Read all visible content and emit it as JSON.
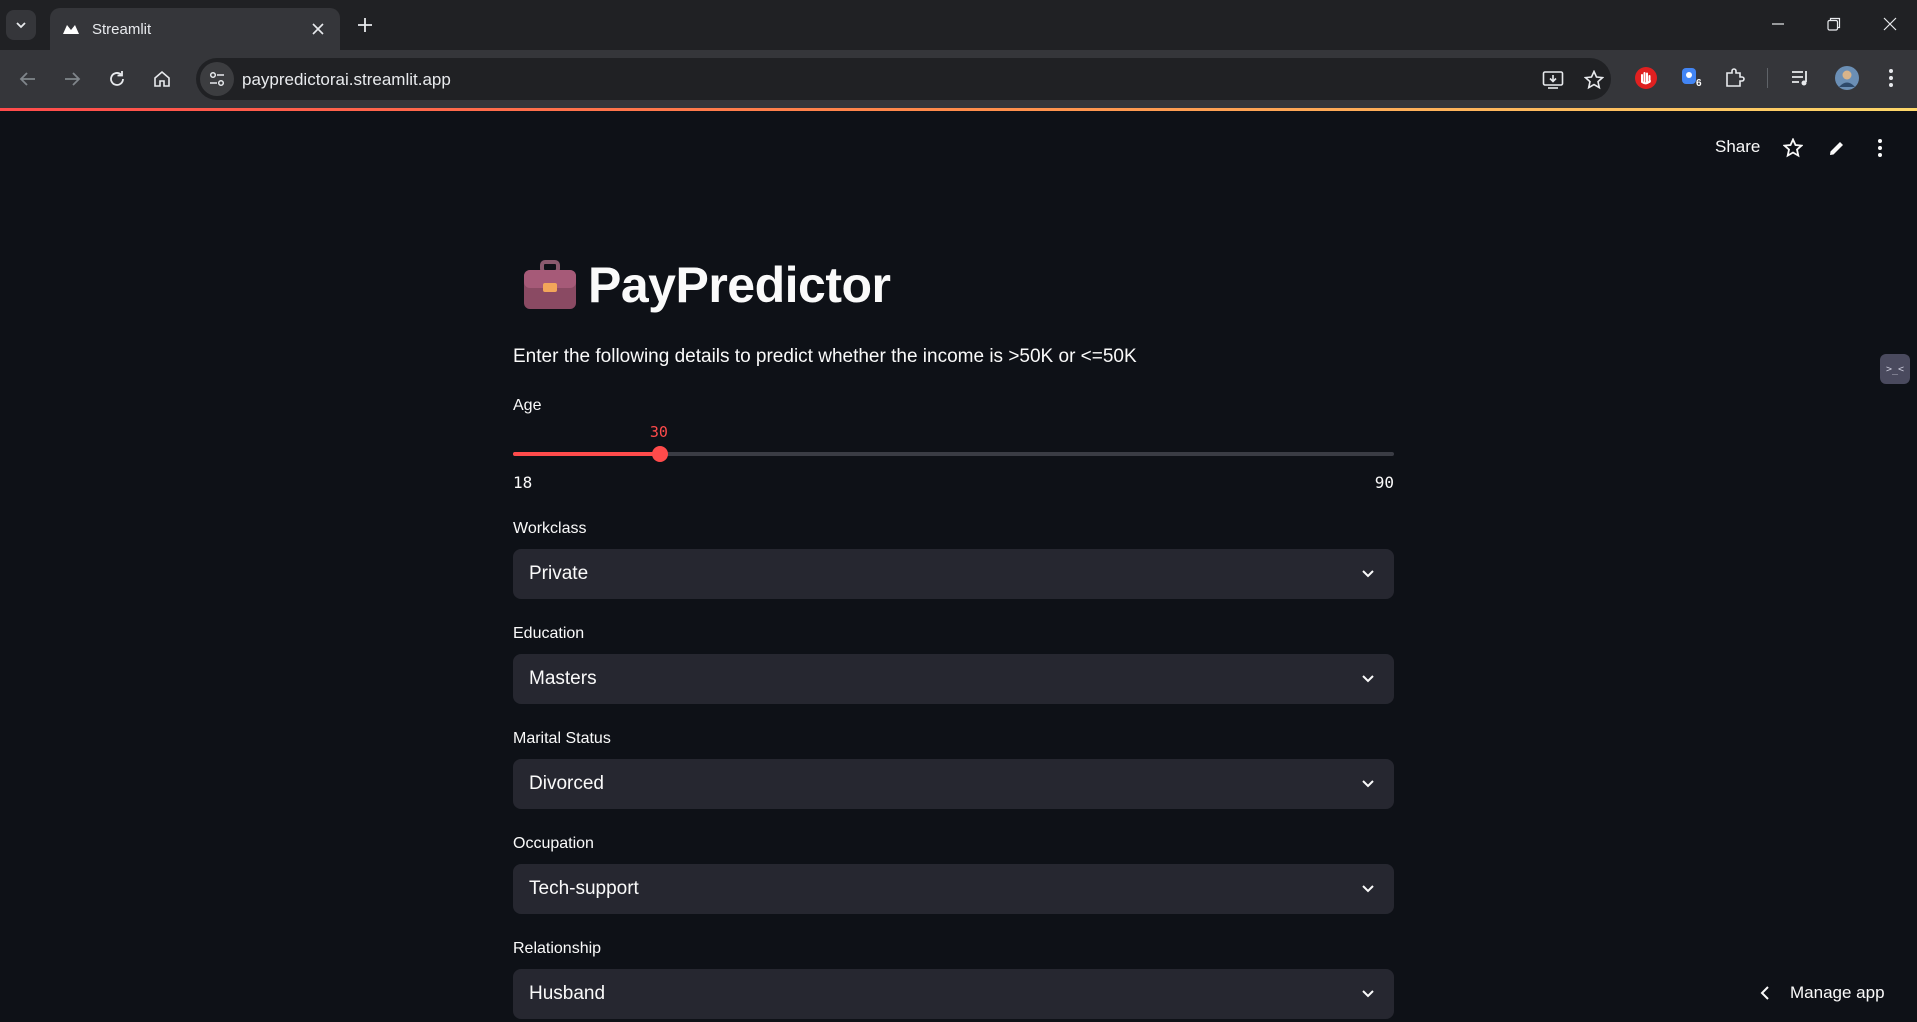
{
  "browser": {
    "tab_title": "Streamlit",
    "url": "paypredictorai.streamlit.app",
    "extension_badge": "6"
  },
  "header": {
    "share_label": "Share"
  },
  "app": {
    "title": "PayPredictor",
    "title_emoji": "briefcase-icon",
    "subtitle": "Enter the following details to predict whether the income is >50K or <=50K",
    "age": {
      "label": "Age",
      "value": 30,
      "min": 18,
      "max": 90,
      "value_label": "30",
      "min_label": "18",
      "max_label": "90"
    },
    "selects": [
      {
        "label": "Workclass",
        "value": "Private"
      },
      {
        "label": "Education",
        "value": "Masters"
      },
      {
        "label": "Marital Status",
        "value": "Divorced"
      },
      {
        "label": "Occupation",
        "value": "Tech-support"
      },
      {
        "label": "Relationship",
        "value": "Husband"
      }
    ],
    "manage_app_label": "Manage app"
  },
  "colors": {
    "accent": "#ff4b4b",
    "background": "#0e1117",
    "input_bg": "#262730",
    "text": "#fafafa"
  }
}
